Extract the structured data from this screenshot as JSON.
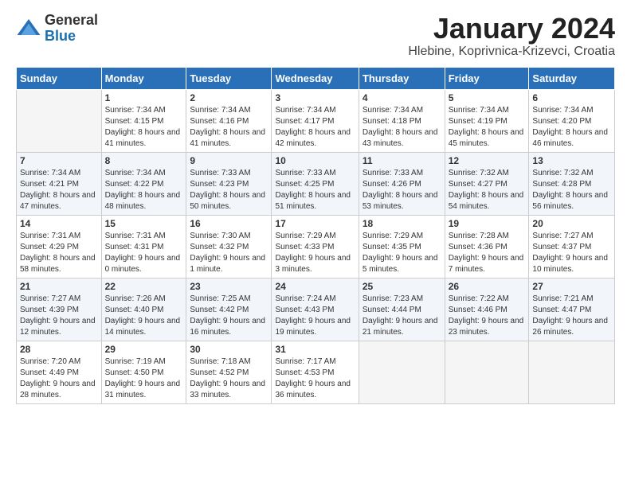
{
  "header": {
    "logo_general": "General",
    "logo_blue": "Blue",
    "month_title": "January 2024",
    "location": "Hlebine, Koprivnica-Krizevci, Croatia"
  },
  "weekdays": [
    "Sunday",
    "Monday",
    "Tuesday",
    "Wednesday",
    "Thursday",
    "Friday",
    "Saturday"
  ],
  "weeks": [
    [
      {
        "day": "",
        "sunrise": "",
        "sunset": "",
        "daylight": "",
        "empty": true
      },
      {
        "day": "1",
        "sunrise": "Sunrise: 7:34 AM",
        "sunset": "Sunset: 4:15 PM",
        "daylight": "Daylight: 8 hours and 41 minutes.",
        "empty": false
      },
      {
        "day": "2",
        "sunrise": "Sunrise: 7:34 AM",
        "sunset": "Sunset: 4:16 PM",
        "daylight": "Daylight: 8 hours and 41 minutes.",
        "empty": false
      },
      {
        "day": "3",
        "sunrise": "Sunrise: 7:34 AM",
        "sunset": "Sunset: 4:17 PM",
        "daylight": "Daylight: 8 hours and 42 minutes.",
        "empty": false
      },
      {
        "day": "4",
        "sunrise": "Sunrise: 7:34 AM",
        "sunset": "Sunset: 4:18 PM",
        "daylight": "Daylight: 8 hours and 43 minutes.",
        "empty": false
      },
      {
        "day": "5",
        "sunrise": "Sunrise: 7:34 AM",
        "sunset": "Sunset: 4:19 PM",
        "daylight": "Daylight: 8 hours and 45 minutes.",
        "empty": false
      },
      {
        "day": "6",
        "sunrise": "Sunrise: 7:34 AM",
        "sunset": "Sunset: 4:20 PM",
        "daylight": "Daylight: 8 hours and 46 minutes.",
        "empty": false
      }
    ],
    [
      {
        "day": "7",
        "sunrise": "Sunrise: 7:34 AM",
        "sunset": "Sunset: 4:21 PM",
        "daylight": "Daylight: 8 hours and 47 minutes.",
        "empty": false
      },
      {
        "day": "8",
        "sunrise": "Sunrise: 7:34 AM",
        "sunset": "Sunset: 4:22 PM",
        "daylight": "Daylight: 8 hours and 48 minutes.",
        "empty": false
      },
      {
        "day": "9",
        "sunrise": "Sunrise: 7:33 AM",
        "sunset": "Sunset: 4:23 PM",
        "daylight": "Daylight: 8 hours and 50 minutes.",
        "empty": false
      },
      {
        "day": "10",
        "sunrise": "Sunrise: 7:33 AM",
        "sunset": "Sunset: 4:25 PM",
        "daylight": "Daylight: 8 hours and 51 minutes.",
        "empty": false
      },
      {
        "day": "11",
        "sunrise": "Sunrise: 7:33 AM",
        "sunset": "Sunset: 4:26 PM",
        "daylight": "Daylight: 8 hours and 53 minutes.",
        "empty": false
      },
      {
        "day": "12",
        "sunrise": "Sunrise: 7:32 AM",
        "sunset": "Sunset: 4:27 PM",
        "daylight": "Daylight: 8 hours and 54 minutes.",
        "empty": false
      },
      {
        "day": "13",
        "sunrise": "Sunrise: 7:32 AM",
        "sunset": "Sunset: 4:28 PM",
        "daylight": "Daylight: 8 hours and 56 minutes.",
        "empty": false
      }
    ],
    [
      {
        "day": "14",
        "sunrise": "Sunrise: 7:31 AM",
        "sunset": "Sunset: 4:29 PM",
        "daylight": "Daylight: 8 hours and 58 minutes.",
        "empty": false
      },
      {
        "day": "15",
        "sunrise": "Sunrise: 7:31 AM",
        "sunset": "Sunset: 4:31 PM",
        "daylight": "Daylight: 9 hours and 0 minutes.",
        "empty": false
      },
      {
        "day": "16",
        "sunrise": "Sunrise: 7:30 AM",
        "sunset": "Sunset: 4:32 PM",
        "daylight": "Daylight: 9 hours and 1 minute.",
        "empty": false
      },
      {
        "day": "17",
        "sunrise": "Sunrise: 7:29 AM",
        "sunset": "Sunset: 4:33 PM",
        "daylight": "Daylight: 9 hours and 3 minutes.",
        "empty": false
      },
      {
        "day": "18",
        "sunrise": "Sunrise: 7:29 AM",
        "sunset": "Sunset: 4:35 PM",
        "daylight": "Daylight: 9 hours and 5 minutes.",
        "empty": false
      },
      {
        "day": "19",
        "sunrise": "Sunrise: 7:28 AM",
        "sunset": "Sunset: 4:36 PM",
        "daylight": "Daylight: 9 hours and 7 minutes.",
        "empty": false
      },
      {
        "day": "20",
        "sunrise": "Sunrise: 7:27 AM",
        "sunset": "Sunset: 4:37 PM",
        "daylight": "Daylight: 9 hours and 10 minutes.",
        "empty": false
      }
    ],
    [
      {
        "day": "21",
        "sunrise": "Sunrise: 7:27 AM",
        "sunset": "Sunset: 4:39 PM",
        "daylight": "Daylight: 9 hours and 12 minutes.",
        "empty": false
      },
      {
        "day": "22",
        "sunrise": "Sunrise: 7:26 AM",
        "sunset": "Sunset: 4:40 PM",
        "daylight": "Daylight: 9 hours and 14 minutes.",
        "empty": false
      },
      {
        "day": "23",
        "sunrise": "Sunrise: 7:25 AM",
        "sunset": "Sunset: 4:42 PM",
        "daylight": "Daylight: 9 hours and 16 minutes.",
        "empty": false
      },
      {
        "day": "24",
        "sunrise": "Sunrise: 7:24 AM",
        "sunset": "Sunset: 4:43 PM",
        "daylight": "Daylight: 9 hours and 19 minutes.",
        "empty": false
      },
      {
        "day": "25",
        "sunrise": "Sunrise: 7:23 AM",
        "sunset": "Sunset: 4:44 PM",
        "daylight": "Daylight: 9 hours and 21 minutes.",
        "empty": false
      },
      {
        "day": "26",
        "sunrise": "Sunrise: 7:22 AM",
        "sunset": "Sunset: 4:46 PM",
        "daylight": "Daylight: 9 hours and 23 minutes.",
        "empty": false
      },
      {
        "day": "27",
        "sunrise": "Sunrise: 7:21 AM",
        "sunset": "Sunset: 4:47 PM",
        "daylight": "Daylight: 9 hours and 26 minutes.",
        "empty": false
      }
    ],
    [
      {
        "day": "28",
        "sunrise": "Sunrise: 7:20 AM",
        "sunset": "Sunset: 4:49 PM",
        "daylight": "Daylight: 9 hours and 28 minutes.",
        "empty": false
      },
      {
        "day": "29",
        "sunrise": "Sunrise: 7:19 AM",
        "sunset": "Sunset: 4:50 PM",
        "daylight": "Daylight: 9 hours and 31 minutes.",
        "empty": false
      },
      {
        "day": "30",
        "sunrise": "Sunrise: 7:18 AM",
        "sunset": "Sunset: 4:52 PM",
        "daylight": "Daylight: 9 hours and 33 minutes.",
        "empty": false
      },
      {
        "day": "31",
        "sunrise": "Sunrise: 7:17 AM",
        "sunset": "Sunset: 4:53 PM",
        "daylight": "Daylight: 9 hours and 36 minutes.",
        "empty": false
      },
      {
        "day": "",
        "sunrise": "",
        "sunset": "",
        "daylight": "",
        "empty": true
      },
      {
        "day": "",
        "sunrise": "",
        "sunset": "",
        "daylight": "",
        "empty": true
      },
      {
        "day": "",
        "sunrise": "",
        "sunset": "",
        "daylight": "",
        "empty": true
      }
    ]
  ]
}
